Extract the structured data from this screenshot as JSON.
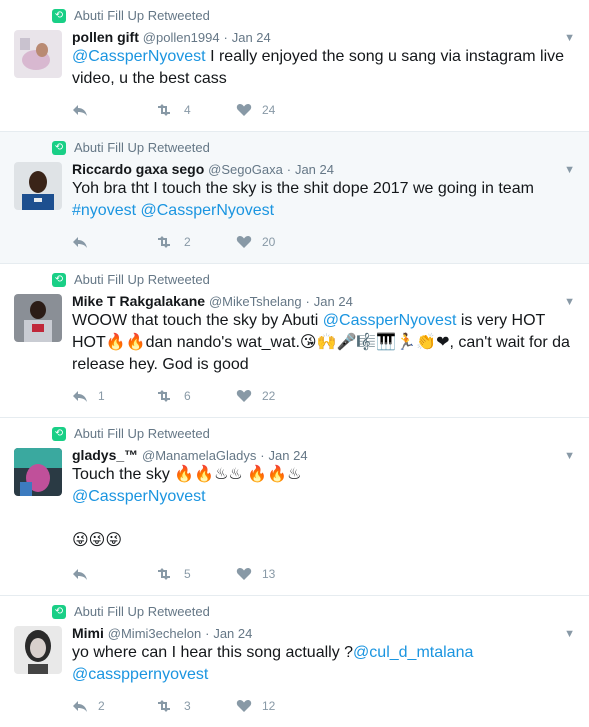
{
  "colors": {
    "retweet_green": "#19cf86",
    "link_blue": "#1b95e0",
    "muted": "#657786",
    "icon": "#8899a6",
    "highlight_bg": "#f5f8fa"
  },
  "tweets": [
    {
      "retweeted_by": "Abuti Fill Up Retweeted",
      "name": "pollen gift",
      "handle": "@pollen1994",
      "date": "Jan 24",
      "text_parts": [
        {
          "t": "@CassperNyovest",
          "link": true
        },
        {
          "t": " I really enjoyed  the song u sang via instagram live video, u the best cass",
          "link": false
        }
      ],
      "reply_count": "",
      "retweet_count": "4",
      "like_count": "24",
      "avatar_icon": "avatar-photo-icon"
    },
    {
      "retweeted_by": "Abuti Fill Up Retweeted",
      "name": "Riccardo gaxa sego",
      "handle": "@SegoGaxa",
      "date": "Jan 24",
      "text_parts": [
        {
          "t": "Yoh bra tht I touch the sky is the shit dope 2017 we going in team ",
          "link": false
        },
        {
          "t": "#nyovest",
          "link": true
        },
        {
          "t": "    ",
          "link": false
        },
        {
          "t": "@CassperNyovest",
          "link": true
        }
      ],
      "reply_count": "",
      "retweet_count": "2",
      "like_count": "20",
      "avatar_icon": "avatar-photo-icon"
    },
    {
      "retweeted_by": "Abuti Fill Up Retweeted",
      "name": "Mike T Rakgalakane",
      "handle": "@MikeTshelang",
      "date": "Jan 24",
      "text_parts": [
        {
          "t": "WOOW that touch the sky by Abuti ",
          "link": false
        },
        {
          "t": "@CassperNyovest",
          "link": true
        },
        {
          "t": " is very HOT HOT🔥🔥dan nando's wat_wat.😘🙌🎤🎼🎹🏃👏❤, can't wait for da release hey. God is good",
          "link": false
        }
      ],
      "reply_count": "1",
      "retweet_count": "6",
      "like_count": "22",
      "avatar_icon": "avatar-photo-icon"
    },
    {
      "retweeted_by": "Abuti Fill Up Retweeted",
      "name": "gladys_™",
      "handle": "@ManamelaGladys",
      "date": "Jan 24",
      "text_parts": [
        {
          "t": "Touch the sky 🔥🔥♨♨ 🔥🔥♨",
          "link": false
        },
        {
          "t": "\n",
          "link": false
        },
        {
          "t": "@CassperNyovest",
          "link": true
        },
        {
          "t": "\n\n😜😜😜",
          "link": false
        }
      ],
      "reply_count": "",
      "retweet_count": "5",
      "like_count": "13",
      "avatar_icon": "avatar-photo-icon"
    },
    {
      "retweeted_by": "Abuti Fill Up Retweeted",
      "name": "Mimi",
      "handle": "@Mimi3echelon",
      "date": "Jan 24",
      "text_parts": [
        {
          "t": "yo where can I hear this song actually ?",
          "link": false
        },
        {
          "t": "@cul_d_mtalana",
          "link": true
        },
        {
          "t": "\n",
          "link": false
        },
        {
          "t": "@cassppernyovest",
          "link": true
        }
      ],
      "reply_count": "2",
      "retweet_count": "3",
      "like_count": "12",
      "avatar_icon": "avatar-photo-icon"
    }
  ]
}
